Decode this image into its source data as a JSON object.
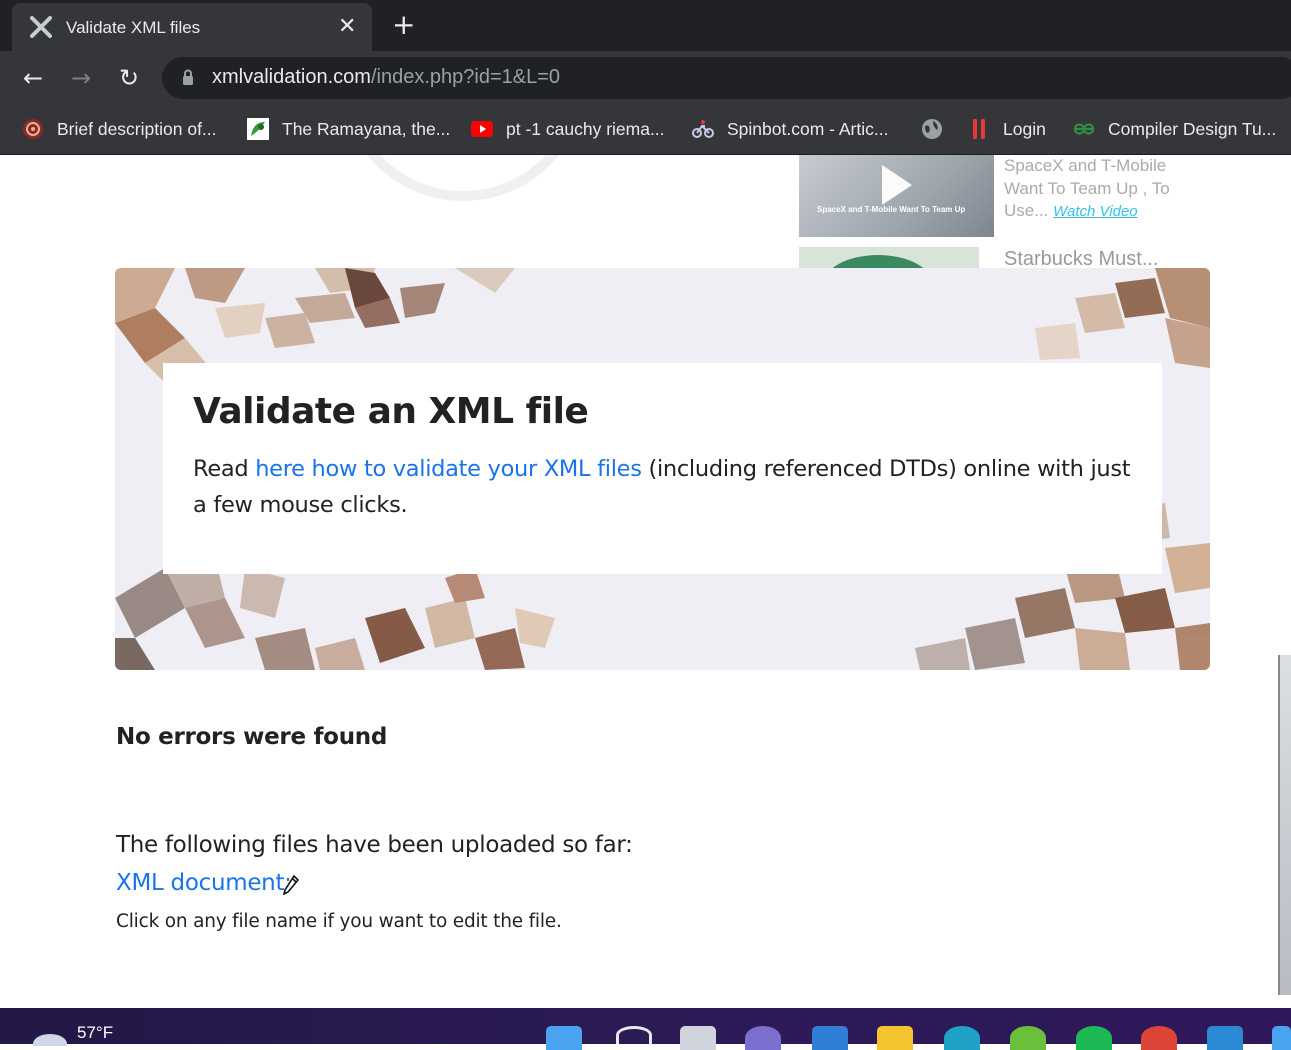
{
  "browser": {
    "tab_title": "Validate XML files",
    "tab_close": "✕",
    "new_tab": "+",
    "url_domain": "xmlvalidation.com",
    "url_path": "/index.php?id=1&L=0",
    "back": "←",
    "forward": "→",
    "reload": "↻"
  },
  "bookmarks": [
    {
      "label": "Brief description of...",
      "icon": "mandala-icon"
    },
    {
      "label": "The Ramayana, the...",
      "icon": "ramayana-icon"
    },
    {
      "label": "pt -1 cauchy riema...",
      "icon": "youtube-icon"
    },
    {
      "label": "Spinbot.com - Artic...",
      "icon": "bike-icon"
    },
    {
      "label": "",
      "icon": "globe-icon"
    },
    {
      "label": "Login",
      "icon": "pause-bars-icon"
    },
    {
      "label": "Compiler Design Tu...",
      "icon": "geeks-icon"
    }
  ],
  "ads": {
    "video_caption": "SpaceX and T-Mobile Want To Team Up",
    "video_text": "SpaceX and T-Mobile Want To Team Up , To Use...",
    "watch_video": "Watch Video",
    "next_title": "Starbucks Must..."
  },
  "hero": {
    "title": "Validate an XML file",
    "desc_prefix": "Read ",
    "desc_link": "here how to validate your XML files",
    "desc_suffix": " (including referenced DTDs) online with just a few mouse clicks."
  },
  "result": {
    "status": "No errors were found",
    "uploaded_label": "The following files have been uploaded so far:",
    "file_link": "XML document:",
    "edit_note": "Click on any file name if you want to edit the file."
  },
  "taskbar": {
    "temperature": "57°F"
  },
  "colors": {
    "link": "#1a73e8",
    "chrome_dark": "#202124",
    "chrome_mid": "#35363a"
  }
}
